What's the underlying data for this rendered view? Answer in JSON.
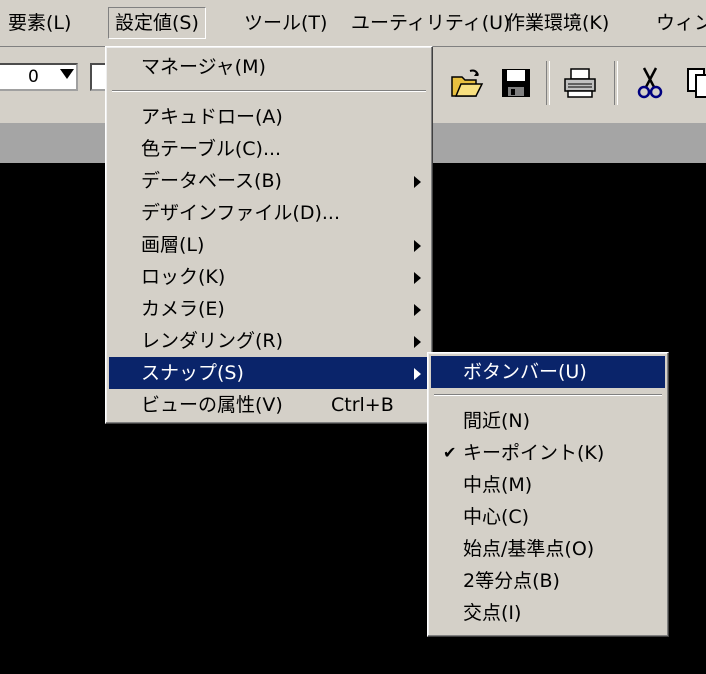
{
  "menubar": {
    "items": [
      {
        "label": "要素(L)"
      },
      {
        "label": "設定値(S)"
      },
      {
        "label": "ツール(T)"
      },
      {
        "label": "ユーティリティ(U)"
      },
      {
        "label": "作業環境(K)"
      },
      {
        "label": "ウィンド"
      }
    ]
  },
  "toolbar": {
    "layer_value": "0",
    "icons": [
      "open-folder-icon",
      "save-icon",
      "print-icon",
      "cut-icon",
      "copy-icon"
    ]
  },
  "settings_menu": {
    "items": [
      {
        "label": "マネージャ(M)"
      },
      {
        "label": "アキュドロー(A)"
      },
      {
        "label": "色テーブル(C)..."
      },
      {
        "label": "データベース(B)"
      },
      {
        "label": "デザインファイル(D)..."
      },
      {
        "label": "画層(L)"
      },
      {
        "label": "ロック(K)"
      },
      {
        "label": "カメラ(E)"
      },
      {
        "label": "レンダリング(R)"
      },
      {
        "label": "スナップ(S)"
      },
      {
        "label": "ビューの属性(V)",
        "shortcut": "Ctrl+B"
      }
    ]
  },
  "snap_submenu": {
    "items": [
      {
        "label": "ボタンバー(U)"
      },
      {
        "label": "間近(N)"
      },
      {
        "label": "キーポイント(K)",
        "checked": true
      },
      {
        "label": "中点(M)"
      },
      {
        "label": "中心(C)"
      },
      {
        "label": "始点/基準点(O)"
      },
      {
        "label": "2等分点(B)"
      },
      {
        "label": "交点(I)"
      }
    ],
    "check_mark": "✔"
  },
  "colors": {
    "menu_face": "#d4d0c8",
    "highlight": "#0a246a",
    "drawing_background": "#000000"
  }
}
